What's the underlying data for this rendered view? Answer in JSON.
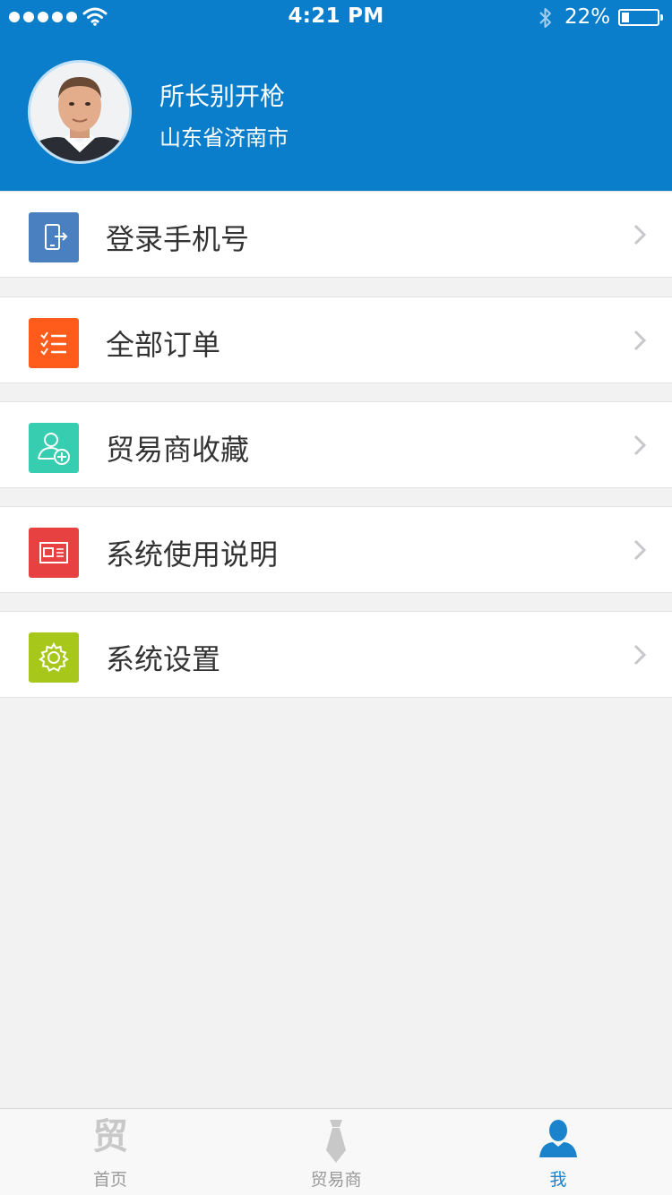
{
  "status_bar": {
    "time": "4:21 PM",
    "battery": "22%",
    "battery_level": 0.22,
    "signal_bars": 5
  },
  "profile": {
    "name": "所长别开枪",
    "location": "山东省济南市"
  },
  "menu": [
    {
      "label": "登录手机号",
      "icon": "phone-login-icon",
      "color": "#4a80c0"
    },
    {
      "label": "全部订单",
      "icon": "order-list-icon",
      "color": "#ff5b1a"
    },
    {
      "label": "贸易商收藏",
      "icon": "user-add-icon",
      "color": "#36cdb0"
    },
    {
      "label": "系统使用说明",
      "icon": "id-card-icon",
      "color": "#e84141"
    },
    {
      "label": "系统设置",
      "icon": "gear-icon",
      "color": "#a7c71a"
    }
  ],
  "tabs": [
    {
      "label": "首页",
      "icon": "trade-char-icon",
      "glyph": "贸",
      "active": false
    },
    {
      "label": "贸易商",
      "icon": "tie-icon",
      "active": false
    },
    {
      "label": "我",
      "icon": "person-icon",
      "active": true
    }
  ],
  "colors": {
    "header": "#0b7ecb",
    "active_tab": "#1a83cc",
    "background": "#f2f2f2"
  }
}
